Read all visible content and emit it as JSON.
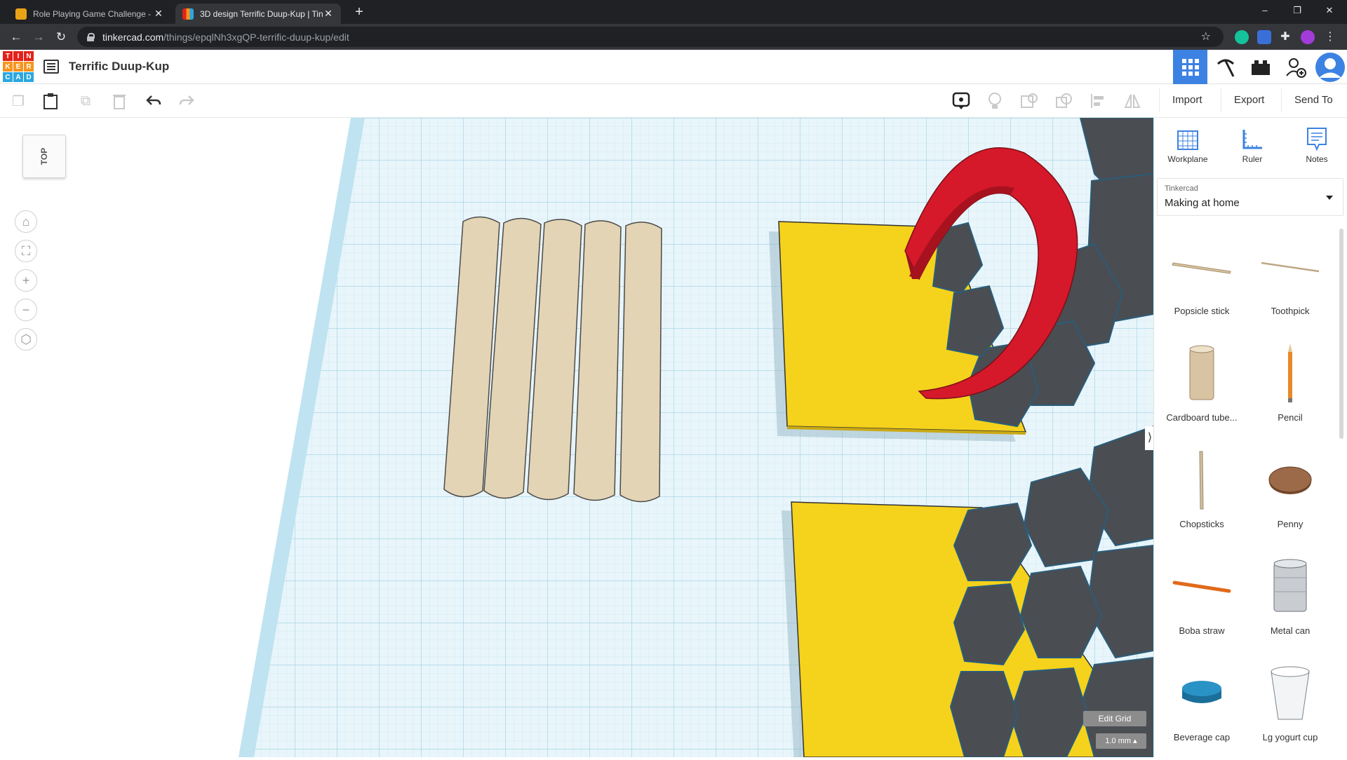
{
  "browser": {
    "tabs": [
      {
        "title": "Role Playing Game Challenge - Ir",
        "favicon_color": "#e8a317"
      },
      {
        "title": "3D design Terrific Duup-Kup | Tin",
        "favicon_color": "#e04e39"
      }
    ],
    "new_tab": "+",
    "url_host": "tinkercad.com",
    "url_path": "/things/epqlNh3xgQP-terrific-duup-kup/edit",
    "window_controls": [
      "–",
      "❐",
      "✕"
    ]
  },
  "app": {
    "logo_letters": [
      "T",
      "I",
      "N",
      "K",
      "E",
      "R",
      "C",
      "A",
      "D"
    ],
    "logo_colors": [
      "#e2231a",
      "#e2231a",
      "#e2231a",
      "#f7941d",
      "#f7941d",
      "#f7941d",
      "#2aa8df",
      "#2aa8df",
      "#2aa8df"
    ],
    "design_title": "Terrific Duup-Kup",
    "accent_color": "#3c82e2"
  },
  "toolbar": {
    "actions": [
      "Import",
      "Export",
      "Send To"
    ]
  },
  "viewport": {
    "viewcube_label": "TOP",
    "edit_grid_label": "Edit Grid",
    "snap_grid_label": "1.0 mm ▴"
  },
  "panel": {
    "tools": [
      "Workplane",
      "Ruler",
      "Notes"
    ],
    "library_source": "Tinkercad",
    "library_name": "Making at home",
    "shapes": [
      {
        "label": "Popsicle stick"
      },
      {
        "label": "Toothpick"
      },
      {
        "label": "Cardboard tube..."
      },
      {
        "label": "Pencil"
      },
      {
        "label": "Chopsticks"
      },
      {
        "label": "Penny"
      },
      {
        "label": "Boba straw"
      },
      {
        "label": "Metal can"
      },
      {
        "label": "Beverage cap"
      },
      {
        "label": "Lg yogurt cup"
      }
    ]
  },
  "colors": {
    "workplane_fill": "#e8f5fa",
    "grid_line": "#b5dde9",
    "popsicle_fill": "#e3d4b5",
    "yellow_box": "#f5d21c",
    "red_arc": "#d5192a",
    "rock_gray": "#4a4d52"
  }
}
